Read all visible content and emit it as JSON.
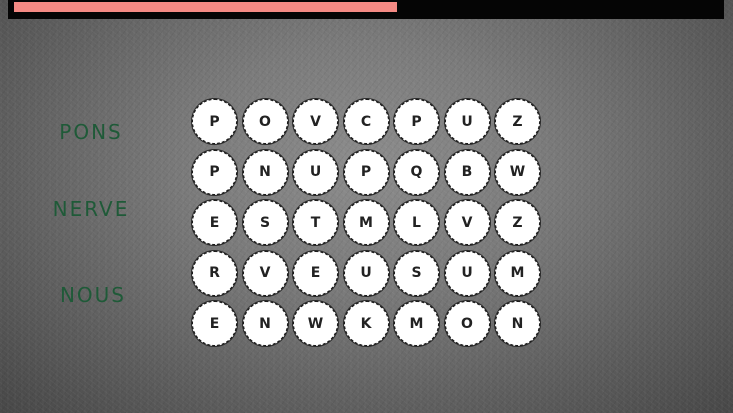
{
  "timer": {
    "remaining_fraction": 0.55,
    "fill_color": "#f48a84"
  },
  "words": [
    "PONS",
    "NERVE",
    "NOUS"
  ],
  "grid": [
    [
      "P",
      "O",
      "V",
      "C",
      "P",
      "U",
      "Z"
    ],
    [
      "P",
      "N",
      "U",
      "P",
      "Q",
      "B",
      "W"
    ],
    [
      "E",
      "S",
      "T",
      "M",
      "L",
      "V",
      "Z"
    ],
    [
      "R",
      "V",
      "E",
      "U",
      "S",
      "U",
      "M"
    ],
    [
      "E",
      "N",
      "W",
      "K",
      "M",
      "O",
      "N"
    ]
  ],
  "colors": {
    "word_text": "#1f5a38",
    "cell_bg": "#ffffff",
    "timer_track": "#050505"
  }
}
